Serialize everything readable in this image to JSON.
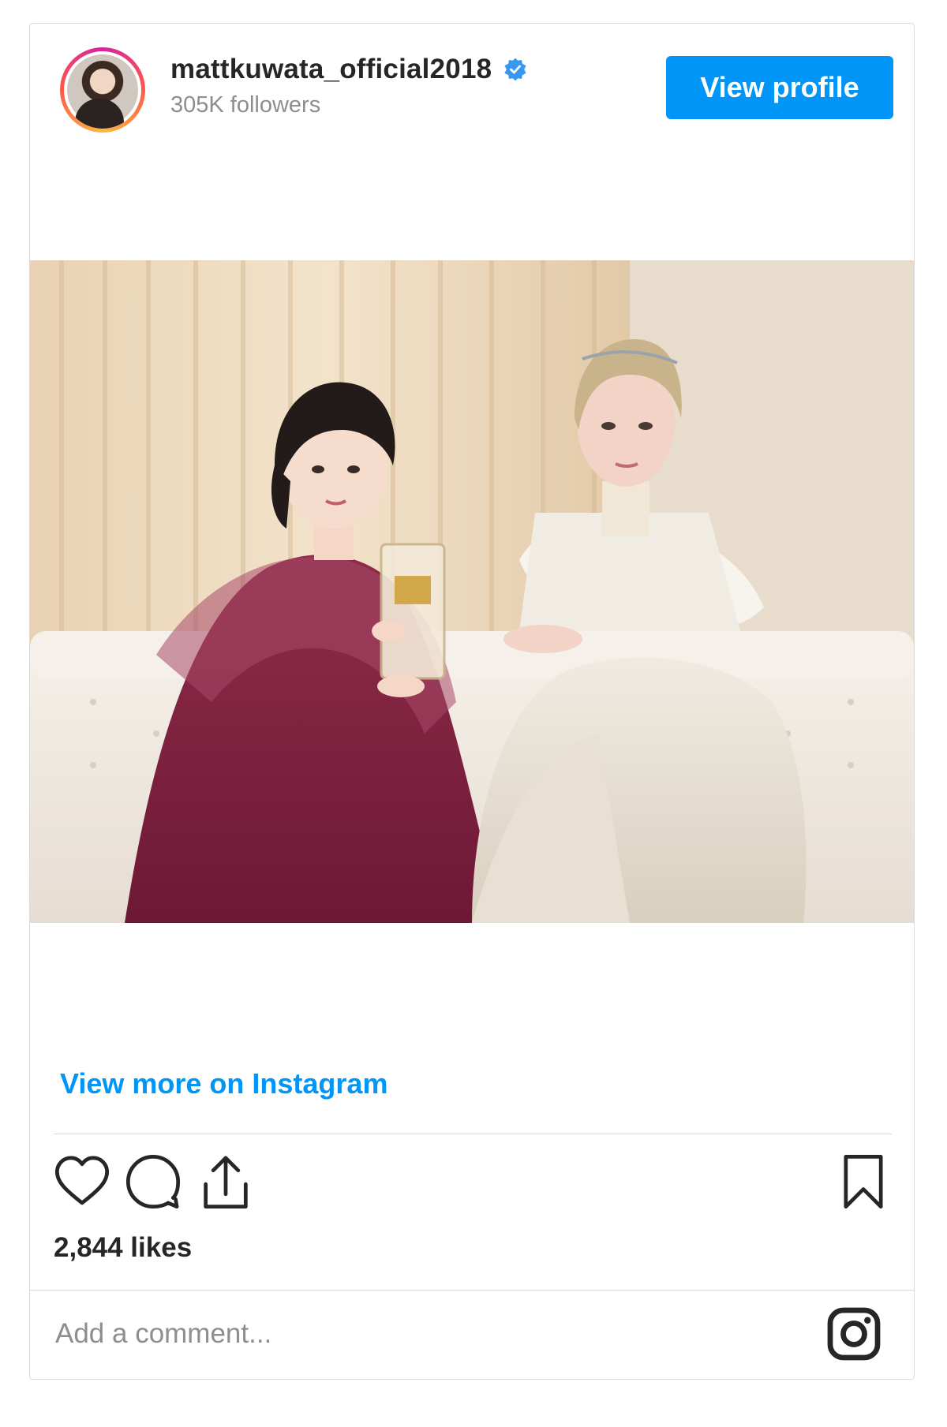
{
  "header": {
    "username": "mattkuwata_official2018",
    "followers": "305K followers",
    "view_profile_label": "View profile"
  },
  "post": {
    "view_more_label": "View more on Instagram",
    "likes": "2,844 likes",
    "comment_placeholder": "Add a comment..."
  },
  "colors": {
    "accent": "#0095f6",
    "text": "#262626",
    "muted": "#8e8e8e",
    "border": "#dbdbdb"
  },
  "icons": [
    "heart-icon",
    "comment-icon",
    "share-icon",
    "bookmark-icon",
    "instagram-icon",
    "verified-icon"
  ]
}
